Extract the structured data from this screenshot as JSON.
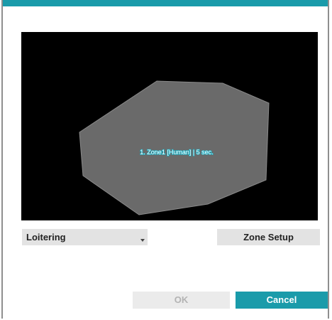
{
  "dialog": {
    "accent_color": "#1a9baa"
  },
  "video": {
    "zone_label": "1. Zone1 [Human] | 5 sec.",
    "zone_fill_color": "#6a6a6a",
    "zone_label_outline_color": "#1aa9bd"
  },
  "controls": {
    "event_type": {
      "selected": "Loitering"
    },
    "zone_setup_label": "Zone Setup"
  },
  "footer": {
    "ok_label": "OK",
    "cancel_label": "Cancel"
  }
}
